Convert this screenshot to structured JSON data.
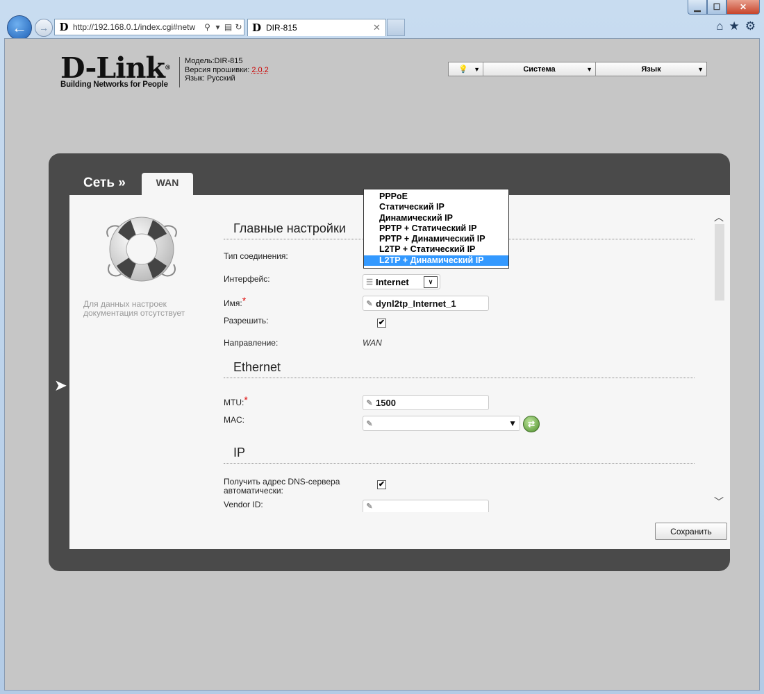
{
  "browser": {
    "url": "http://192.168.0.1/index.cgi#netw",
    "tab_title": "DIR-815",
    "favicon_letter": "D"
  },
  "header": {
    "brand": "D-Link",
    "trademark": "®",
    "tagline": "Building Networks for People",
    "model_label": "Модель:",
    "model_value": "DIR-815",
    "firmware_label": "Версия прошивки:",
    "firmware_value": "2.0.2",
    "language_label": "Язык:",
    "language_value": "Русский"
  },
  "topmenu": {
    "system": "Система",
    "language": "Язык"
  },
  "breadcrumb": {
    "section": "Сеть »",
    "tab": "WAN"
  },
  "sidebar": {
    "nodoc": "Для данных настроек документация отсутствует"
  },
  "main": {
    "sections": {
      "general": "Главные настройки",
      "ethernet": "Ethernet",
      "ip": "IP"
    },
    "labels": {
      "conn_type": "Тип соединения:",
      "interface": "Интерфейс:",
      "name": "Имя:",
      "enable": "Разрешить:",
      "direction": "Направление:",
      "mtu": "MTU:",
      "mac": "MAC:",
      "dns_auto": "Получить адрес DNS-сервера автоматически:",
      "vendor_id": "Vendor ID:"
    },
    "required_mark": "*",
    "values": {
      "interface": "Internet",
      "name": "dynl2tp_Internet_1",
      "enable_checked": "✔",
      "direction": "WAN",
      "mtu": "1500",
      "mac": "",
      "dns_auto_checked": "✔",
      "vendor_id": ""
    },
    "connection_types": [
      "PPPoE",
      "Статический IP",
      "Динамический IP",
      "PPTP + Статический IP",
      "PPTP + Динамический IP",
      "L2TP + Статический IP",
      "L2TP + Динамический IP"
    ],
    "selected_connection_type_index": 6,
    "save_label": "Сохранить"
  },
  "icons": {
    "back": "back-arrow-icon",
    "forward": "forward-arrow-icon",
    "home": "home-icon",
    "favorites": "star-icon",
    "tools": "gear-icon",
    "help": "lightbulb-icon",
    "lifebuoy": "lifebuoy-icon",
    "mac_clone": "refresh-arrows-icon"
  },
  "colors": {
    "panel_bg": "#4a4a4a",
    "page_bg": "#c6c6c6",
    "selected_option": "#3399ff",
    "required": "#dd0000"
  }
}
